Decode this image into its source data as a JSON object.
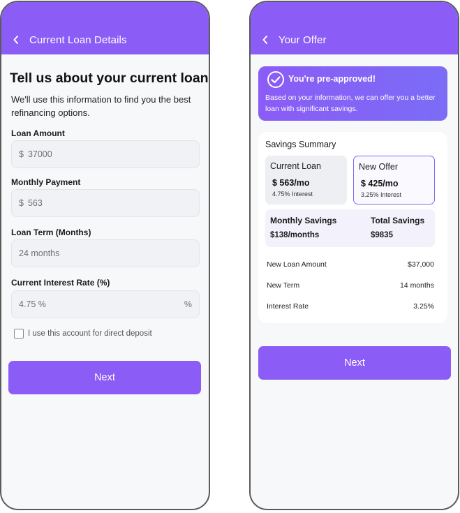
{
  "left": {
    "header_title": "Current Loan Details",
    "heading": "Tell us about your current loan",
    "description": "We'll use this information to find you the best refinancing options.",
    "fields": {
      "loan_amount": {
        "label": "Loan Amount",
        "prefix": "$",
        "value": "37000"
      },
      "monthly_payment": {
        "label": "Monthly Payment",
        "prefix": "$",
        "value": "563"
      },
      "loan_term": {
        "label": "Loan Term (Months)",
        "value": "24 months"
      },
      "interest_rate": {
        "label": "Current Interest Rate (%)",
        "value": "4.75 %",
        "suffix": "%"
      }
    },
    "checkbox_label": "I use this account for direct deposit",
    "next_label": "Next"
  },
  "right": {
    "header_title": "Your Offer",
    "preapproved": {
      "title": "You're pre-approved!",
      "description": "Based on your information, we can offer you a better loan with significant savings."
    },
    "savings_summary": {
      "title": "Savings Summary",
      "current": {
        "title": "Current Loan",
        "amount": "$ 563/mo",
        "interest": "4.75% Interest"
      },
      "new_offer": {
        "title": "New Offer",
        "amount": "$ 425/mo",
        "interest": "3.25% Interest"
      },
      "monthly_savings": {
        "label": "Monthly Savings",
        "value": "$138/months"
      },
      "total_savings": {
        "label": "Total Savings",
        "value": "$9835"
      },
      "details": [
        {
          "label": "New Loan Amount",
          "value": "$37,000"
        },
        {
          "label": "New Term",
          "value": "14 months"
        },
        {
          "label": "Interest Rate",
          "value": "3.25%"
        }
      ]
    },
    "next_label": "Next"
  },
  "colors": {
    "accent": "#8b5cf6",
    "frame": "#5b5b5b",
    "background": "#f7f8fa"
  }
}
